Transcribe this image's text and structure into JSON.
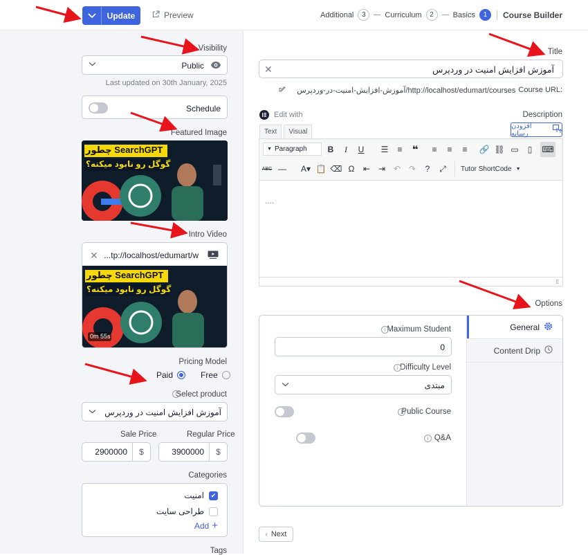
{
  "header": {
    "update_label": "Update",
    "preview_label": "Preview",
    "steps": [
      {
        "label": "Additional",
        "num": "3"
      },
      {
        "label": "Curriculum",
        "num": "2"
      },
      {
        "label": "Basics",
        "num": "1"
      }
    ],
    "title": "Course Builder"
  },
  "sidebar": {
    "visibility_label": "Visibility",
    "visibility_value": "Public",
    "last_updated": "Last updated on 30th January, 2025",
    "schedule_label": "Schedule",
    "featured_image_label": "Featured Image",
    "intro_video_label": "Intro Video",
    "intro_video_url": "...tp://localhost/edumart/w",
    "video_duration": "0m 55s",
    "thumb_line1": "چطور SearchGPT",
    "thumb_line2": "گوگل رو نابود میکنه؟",
    "pricing_label": "Pricing Model",
    "paid_label": "Paid",
    "free_label": "Free",
    "select_product_label": "Select product",
    "selected_product": "آموزش افزایش امنیت در وردپرس",
    "sale_price_label": "Sale Price",
    "sale_price": "2900000",
    "regular_price_label": "Regular Price",
    "regular_price": "3900000",
    "currency": "$",
    "categories_label": "Categories",
    "categories": [
      {
        "label": "امنیت",
        "checked": true
      },
      {
        "label": "طراحی سایت",
        "checked": false
      }
    ],
    "add_label": "Add",
    "tags_label": "Tags"
  },
  "main": {
    "title_label": "Title",
    "title_value": "آموزش افزایش امنیت در وردپرس",
    "course_url_label": "Course URL:",
    "course_url": "http://localhost/edumart/courses/آموزش-افزایش-امنیت-در-وردپرس",
    "edit_with": "Edit with",
    "description_label": "Description",
    "tab_text": "Text",
    "tab_visual": "Visual",
    "add_media": "افزودن رسانه",
    "paragraph": "Paragraph",
    "shortcode": "Tutor ShortCode",
    "editor_placeholder": "....",
    "options_label": "Options",
    "max_student_label": "Maximum Student",
    "max_student_value": "0",
    "difficulty_label": "Difficulty Level",
    "difficulty_value": "مبتدی",
    "public_course_label": "Public Course",
    "qa_label": "Q&A",
    "tab_general": "General",
    "tab_content_drip": "Content Drip",
    "next_label": "Next"
  },
  "colors": {
    "accent": "#3e64de",
    "annotation": "#e8141c"
  }
}
